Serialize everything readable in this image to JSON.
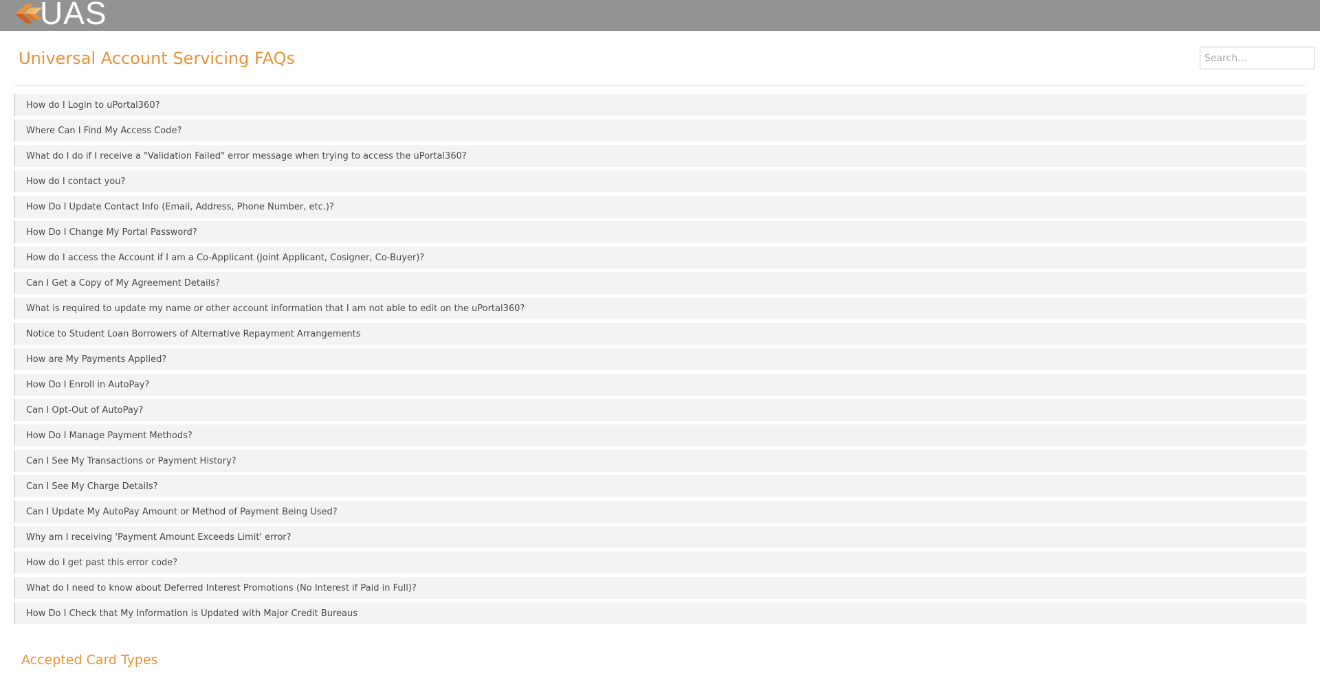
{
  "header": {
    "logo_text": "UAS",
    "brand_color": "#e8923a",
    "bar_color": "#939393",
    "logo_icon": "uas-logo-icon"
  },
  "page": {
    "title": "Universal Account Servicing FAQs"
  },
  "search": {
    "placeholder": "Search..."
  },
  "faqs": [
    "How do I Login to uPortal360?",
    "Where Can I Find My Access Code?",
    "What do I do if I receive a \"Validation Failed\" error message when trying to access the uPortal360?",
    "How do I contact you?",
    "How Do I Update Contact Info (Email, Address, Phone Number, etc.)?",
    "How Do I Change My Portal Password?",
    "How do I access the Account if I am a Co-Applicant (Joint Applicant, Cosigner, Co-Buyer)?",
    "Can I Get a Copy of My Agreement Details?",
    "What is required to update my name or other account information that I am not able to edit on the uPortal360?",
    "Notice to Student Loan Borrowers of Alternative Repayment Arrangements",
    "How are My Payments Applied?",
    "How Do I Enroll in AutoPay?",
    "Can I Opt-Out of AutoPay?",
    "How Do I Manage Payment Methods?",
    "Can I See My Transactions or Payment History?",
    "Can I See My Charge Details?",
    "Can I Update My AutoPay Amount or Method of Payment Being Used?",
    "Why am I receiving 'Payment Amount Exceeds Limit' error?",
    "How do I get past this error code?",
    "What do I need to know about Deferred Interest Promotions (No Interest if Paid in Full)?",
    "How Do I Check that My Information is Updated with Major Credit Bureaus"
  ],
  "sections": {
    "accepted_cards_title": "Accepted Card Types"
  }
}
